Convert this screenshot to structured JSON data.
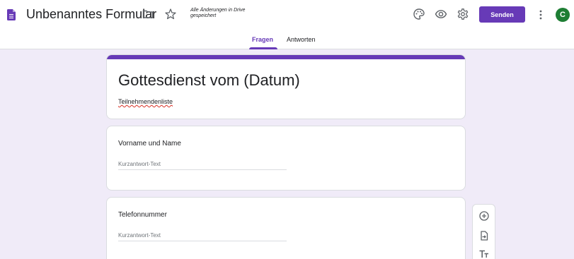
{
  "header": {
    "title": "Unbenanntes Formular",
    "save_status": "Alle Änderungen in Drive gespeichert",
    "send_label": "Senden",
    "avatar_initial": "C",
    "accent_color": "#673ab7",
    "icons": [
      "forms-doc-icon",
      "folder-icon",
      "star-icon",
      "palette-icon",
      "eye-icon",
      "settings-icon",
      "more-vert-icon"
    ]
  },
  "tabs": [
    {
      "label": "Fragen",
      "active": true
    },
    {
      "label": "Antworten",
      "active": false
    }
  ],
  "form": {
    "title": "Gottesdienst vom (Datum)",
    "description": "Teilnehmendenliste"
  },
  "questions": [
    {
      "title": "Vorname und Name",
      "placeholder": "Kurzantwort-Text"
    },
    {
      "title": "Telefonnummer",
      "placeholder": "Kurzantwort-Text"
    }
  ],
  "side_toolbar": {
    "icons": [
      "add-question-icon",
      "import-questions-icon",
      "add-title-icon"
    ]
  }
}
